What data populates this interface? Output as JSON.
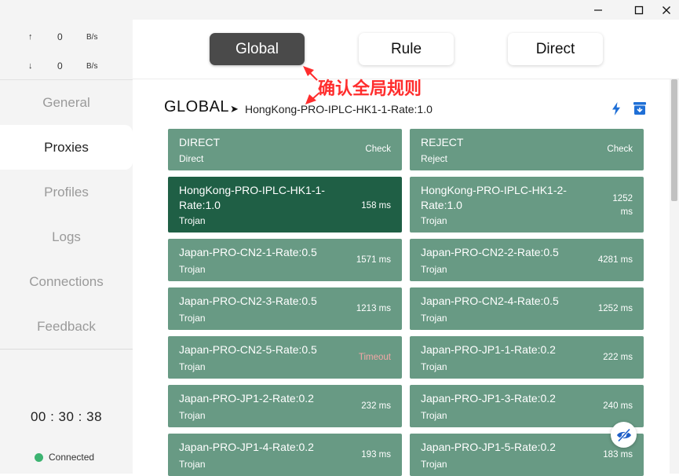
{
  "window": {
    "controls": [
      "minimize-icon",
      "maximize-icon",
      "close-icon"
    ]
  },
  "sidebar": {
    "traffic": {
      "up": {
        "arrow": "↑",
        "value": "0",
        "unit": "B/s"
      },
      "down": {
        "arrow": "↓",
        "value": "0",
        "unit": "B/s"
      }
    },
    "items": [
      {
        "label": "General",
        "active": false
      },
      {
        "label": "Proxies",
        "active": true
      },
      {
        "label": "Profiles",
        "active": false
      },
      {
        "label": "Logs",
        "active": false
      },
      {
        "label": "Connections",
        "active": false
      },
      {
        "label": "Feedback",
        "active": false
      }
    ],
    "timer": "00 : 30 : 38",
    "status": "Connected",
    "status_color": "#3cb371"
  },
  "modes": [
    {
      "label": "Global",
      "active": true
    },
    {
      "label": "Rule",
      "active": false
    },
    {
      "label": "Direct",
      "active": false
    }
  ],
  "annotation": {
    "text": "确认全局规则",
    "color": "#ff2d2d"
  },
  "group": {
    "title": "GLOBAL",
    "arrow": "➤",
    "selected": "HongKong-PRO-IPLC-HK1-1-Rate:1.0",
    "actions": [
      "bolt-icon",
      "archive-box-icon"
    ],
    "accent": "#1f6fd6"
  },
  "proxies": [
    {
      "name": "DIRECT",
      "type": "Direct",
      "delay": "Check",
      "selected": false
    },
    {
      "name": "REJECT",
      "type": "Reject",
      "delay": "Check",
      "selected": false
    },
    {
      "name": "HongKong-PRO-IPLC-HK1-1-Rate:1.0",
      "type": "Trojan",
      "delay": "158 ms",
      "selected": true
    },
    {
      "name": "HongKong-PRO-IPLC-HK1-2-Rate:1.0",
      "type": "Trojan",
      "delay": "1252 ms",
      "selected": false
    },
    {
      "name": "Japan-PRO-CN2-1-Rate:0.5",
      "type": "Trojan",
      "delay": "1571 ms",
      "selected": false
    },
    {
      "name": "Japan-PRO-CN2-2-Rate:0.5",
      "type": "Trojan",
      "delay": "4281 ms",
      "selected": false
    },
    {
      "name": "Japan-PRO-CN2-3-Rate:0.5",
      "type": "Trojan",
      "delay": "1213 ms",
      "selected": false
    },
    {
      "name": "Japan-PRO-CN2-4-Rate:0.5",
      "type": "Trojan",
      "delay": "1252 ms",
      "selected": false
    },
    {
      "name": "Japan-PRO-CN2-5-Rate:0.5",
      "type": "Trojan",
      "delay": "Timeout",
      "selected": false
    },
    {
      "name": "Japan-PRO-JP1-1-Rate:0.2",
      "type": "Trojan",
      "delay": "222 ms",
      "selected": false
    },
    {
      "name": "Japan-PRO-JP1-2-Rate:0.2",
      "type": "Trojan",
      "delay": "232 ms",
      "selected": false
    },
    {
      "name": "Japan-PRO-JP1-3-Rate:0.2",
      "type": "Trojan",
      "delay": "240 ms",
      "selected": false
    },
    {
      "name": "Japan-PRO-JP1-4-Rate:0.2",
      "type": "Trojan",
      "delay": "193 ms",
      "selected": false
    },
    {
      "name": "Japan-PRO-JP1-5-Rate:0.2",
      "type": "Trojan",
      "delay": "183 ms",
      "selected": false
    }
  ],
  "colors": {
    "proxy_bg": "#689a84",
    "proxy_selected_bg": "#1f5f45",
    "timeout": "#f3a6a6",
    "active_mode_bg": "#4a4a4a"
  },
  "floating": {
    "icon": "eye-slash-icon"
  }
}
